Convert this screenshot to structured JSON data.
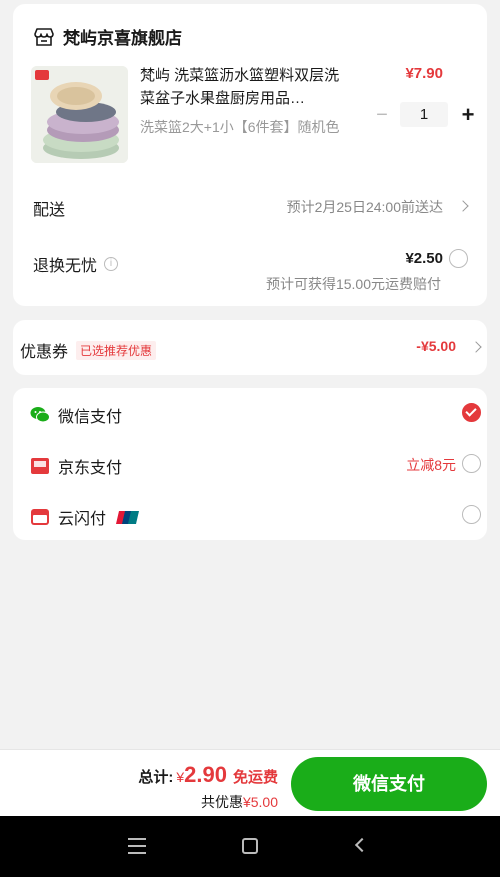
{
  "shop": {
    "name": "梵屿京喜旗舰店"
  },
  "product": {
    "title": "梵屿 洗菜篮沥水篮塑料双层洗菜盆子水果盘厨房用品…",
    "spec": "洗菜篮2大+1小【6件套】随机色",
    "price": "¥7.90",
    "quantity": "1",
    "minus": "−",
    "plus": "+"
  },
  "delivery": {
    "label": "配送",
    "value": "预计2月25日24:00前送达"
  },
  "return_service": {
    "label": "退换无忧",
    "info_glyph": "i",
    "price": "¥2.50",
    "sub": "预计可获得15.00元运费赔付"
  },
  "coupon": {
    "label": "优惠券",
    "tag": "已选推荐优惠",
    "value": "-¥5.00"
  },
  "payment_methods": [
    {
      "label": "微信支付",
      "icon": "wechat-pay-icon",
      "selected": true,
      "promo": ""
    },
    {
      "label": "京东支付",
      "icon": "jd-pay-icon",
      "selected": false,
      "promo": "立减8元"
    },
    {
      "label": "云闪付",
      "icon": "quickpass-icon",
      "selected": false,
      "promo": ""
    }
  ],
  "summary": {
    "total_label": "总计:",
    "currency": "¥",
    "total_amount": "2.90",
    "free_shipping": "免运费",
    "discount_label": "共优惠",
    "discount_value": "¥5.00"
  },
  "pay_button": {
    "label": "微信支付"
  },
  "colors": {
    "accent_red": "#e4393c",
    "pay_green": "#1aad19"
  }
}
